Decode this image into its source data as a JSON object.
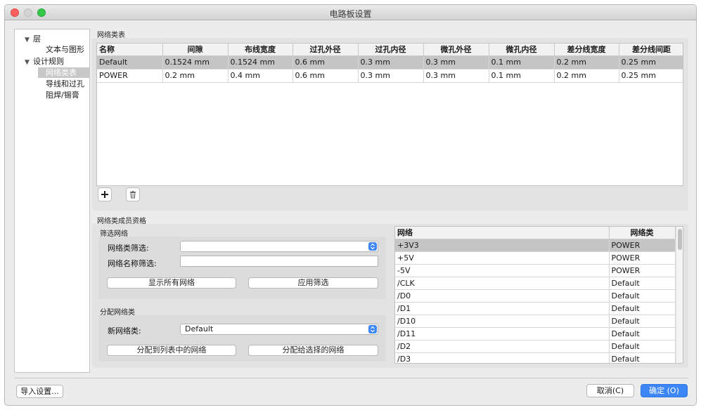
{
  "window": {
    "title": "电路板设置"
  },
  "tree": {
    "items": [
      {
        "label": "层",
        "arrow": "▼"
      },
      {
        "label": "文本与图形"
      },
      {
        "label": "设计规则",
        "arrow": "▼"
      },
      {
        "label": "网络类表"
      },
      {
        "label": "导线和过孔"
      },
      {
        "label": "阻焊/锡膏"
      }
    ]
  },
  "netclasses": {
    "section_label": "网络类表",
    "headers": [
      "名称",
      "间隙",
      "布线宽度",
      "过孔外径",
      "过孔内径",
      "微孔外径",
      "微孔内径",
      "差分线宽度",
      "差分线间距"
    ],
    "rows": [
      [
        "Default",
        "0.1524 mm",
        "0.1524 mm",
        "0.6 mm",
        "0.3 mm",
        "0.3 mm",
        "0.1 mm",
        "0.2 mm",
        "0.25 mm"
      ],
      [
        "POWER",
        "0.2 mm",
        "0.4 mm",
        "0.6 mm",
        "0.3 mm",
        "0.3 mm",
        "0.1 mm",
        "0.2 mm",
        "0.25 mm"
      ]
    ],
    "add_icon": "plus-icon",
    "delete_icon": "trash-icon"
  },
  "membership": {
    "section_label": "网络类成员资格",
    "filter": {
      "group_label": "筛选网络",
      "netclass_filter_label": "网络类筛选:",
      "netclass_filter_value": "",
      "netname_filter_label": "网络名称筛选:",
      "netname_filter_value": "",
      "show_all_button": "显示所有网络",
      "apply_button": "应用筛选"
    },
    "assign": {
      "group_label": "分配网络类",
      "new_netclass_label": "新网络类:",
      "new_netclass_value": "Default",
      "assign_listed_button": "分配到列表中的网络",
      "assign_selected_button": "分配给选择的网络"
    },
    "nets": {
      "headers": [
        "网络",
        "网络类"
      ],
      "rows": [
        [
          "+3V3",
          "POWER"
        ],
        [
          "+5V",
          "POWER"
        ],
        [
          "-5V",
          "POWER"
        ],
        [
          "/CLK",
          "Default"
        ],
        [
          "/D0",
          "Default"
        ],
        [
          "/D1",
          "Default"
        ],
        [
          "/D10",
          "Default"
        ],
        [
          "/D11",
          "Default"
        ],
        [
          "/D2",
          "Default"
        ],
        [
          "/D3",
          "Default"
        ]
      ]
    }
  },
  "footer": {
    "import_button": "导入设置...",
    "cancel_button": "取消(C)",
    "ok_button": "确定 (O)"
  },
  "colors": {
    "accent": "#3d86f6",
    "selection": "#c5c5c5",
    "close": "#fc605c",
    "zoom": "#34c84a"
  }
}
